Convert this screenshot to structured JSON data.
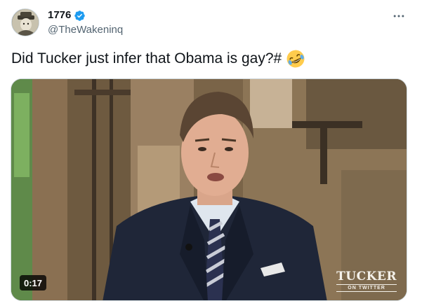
{
  "author": {
    "display_name": "1776",
    "handle": "@TheWakeninq",
    "verified": true
  },
  "tweet": {
    "text": "Did Tucker just infer that Obama is gay?#",
    "emoji": "rolling-on-floor-laughing"
  },
  "media": {
    "type": "video",
    "duration": "0:17",
    "watermark_main": "TUCKER",
    "watermark_sub": "ON TWITTER"
  },
  "colors": {
    "text": "#0f1419",
    "secondary": "#536471",
    "verified": "#1d9bf0",
    "border": "#cfd9de"
  },
  "icons": [
    "avatar",
    "verified-badge-icon",
    "more-options-icon",
    "laughing-emoji-icon"
  ]
}
